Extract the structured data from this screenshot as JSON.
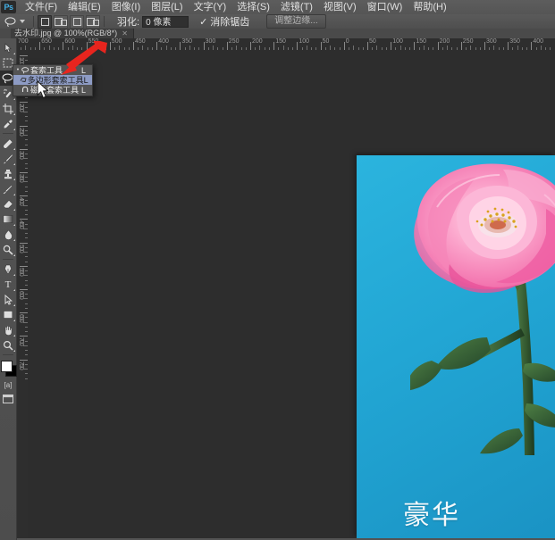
{
  "app": {
    "name": "Photoshop",
    "logo_text": "Ps"
  },
  "menubar": {
    "items": [
      {
        "label": "文件(F)",
        "name": "menu-file"
      },
      {
        "label": "编辑(E)",
        "name": "menu-edit"
      },
      {
        "label": "图像(I)",
        "name": "menu-image"
      },
      {
        "label": "图层(L)",
        "name": "menu-layer"
      },
      {
        "label": "文字(Y)",
        "name": "menu-type"
      },
      {
        "label": "选择(S)",
        "name": "menu-select"
      },
      {
        "label": "滤镜(T)",
        "name": "menu-filter"
      },
      {
        "label": "视图(V)",
        "name": "menu-view"
      },
      {
        "label": "窗口(W)",
        "name": "menu-window"
      },
      {
        "label": "帮助(H)",
        "name": "menu-help"
      }
    ]
  },
  "optionsbar": {
    "tool_icon": "lasso-icon",
    "selection_modes": [
      {
        "name": "new-selection",
        "active": true
      },
      {
        "name": "add-to-selection",
        "active": false
      },
      {
        "name": "subtract-from-selection",
        "active": false
      },
      {
        "name": "intersect-with-selection",
        "active": false
      }
    ],
    "feather_label": "羽化:",
    "feather_value": "0 像素",
    "antialias_label": "消除锯齿",
    "antialias_checked": true,
    "refine_edge_label": "调整边缘..."
  },
  "document": {
    "tab_title": "去水印.jpg @ 100%(RGB/8*)",
    "close_glyph": "✕"
  },
  "rulers": {
    "unit": "px",
    "horizontal_labels": [
      "700",
      "650",
      "600",
      "550",
      "500",
      "450",
      "400",
      "350",
      "300",
      "250",
      "200",
      "150",
      "100",
      "50",
      "0",
      "50",
      "100",
      "150",
      "200",
      "250",
      "300",
      "350",
      "400"
    ],
    "vertical_labels": [
      "100",
      "150",
      "200",
      "250",
      "300",
      "350",
      "400",
      "450",
      "500",
      "550",
      "600",
      "650",
      "700",
      "750"
    ]
  },
  "toolbar": {
    "tools": [
      {
        "name": "move-tool",
        "glyph": "move"
      },
      {
        "name": "marquee-tool",
        "glyph": "marquee"
      },
      {
        "name": "lasso-tool",
        "glyph": "lasso",
        "active": true
      },
      {
        "name": "quick-selection-tool",
        "glyph": "quickselect"
      },
      {
        "name": "crop-tool",
        "glyph": "crop"
      },
      {
        "name": "eyedropper-tool",
        "glyph": "eyedropper"
      },
      {
        "name": "healing-brush-tool",
        "glyph": "healing"
      },
      {
        "name": "brush-tool",
        "glyph": "brush"
      },
      {
        "name": "clone-stamp-tool",
        "glyph": "stamp"
      },
      {
        "name": "history-brush-tool",
        "glyph": "historybrush"
      },
      {
        "name": "eraser-tool",
        "glyph": "eraser"
      },
      {
        "name": "gradient-tool",
        "glyph": "gradient"
      },
      {
        "name": "blur-tool",
        "glyph": "blur"
      },
      {
        "name": "dodge-tool",
        "glyph": "dodge"
      },
      {
        "name": "pen-tool",
        "glyph": "pen"
      },
      {
        "name": "type-tool",
        "glyph": "T"
      },
      {
        "name": "path-selection-tool",
        "glyph": "pathselect"
      },
      {
        "name": "rectangle-tool",
        "glyph": "rectangle"
      },
      {
        "name": "hand-tool",
        "glyph": "hand"
      },
      {
        "name": "zoom-tool",
        "glyph": "zoom"
      }
    ],
    "foreground_color": "#ffffff",
    "background_color": "#000000",
    "quickmask_label": "[a]",
    "screenmode_name": "screen-mode-button"
  },
  "flyout_menu": {
    "items": [
      {
        "label": "套索工具",
        "shortcut": "L",
        "selected": false,
        "bullet": "•",
        "icon": "lasso-icon"
      },
      {
        "label": "多边形套索工具",
        "shortcut": "L",
        "selected": true,
        "bullet": "",
        "icon": "polygonal-lasso-icon"
      },
      {
        "label": "磁性套索工具",
        "shortcut": "L",
        "selected": false,
        "bullet": "",
        "icon": "magnetic-lasso-icon"
      }
    ]
  },
  "image": {
    "watermark_text": "豪华",
    "background_color": "#23a8d6",
    "flower_color": "#f06ba8",
    "stem_color": "#3d6b3a"
  },
  "annotations": {
    "arrow_color": "#e8251e",
    "arrow_name": "red-pointer-arrow",
    "cursor_name": "mouse-cursor"
  }
}
